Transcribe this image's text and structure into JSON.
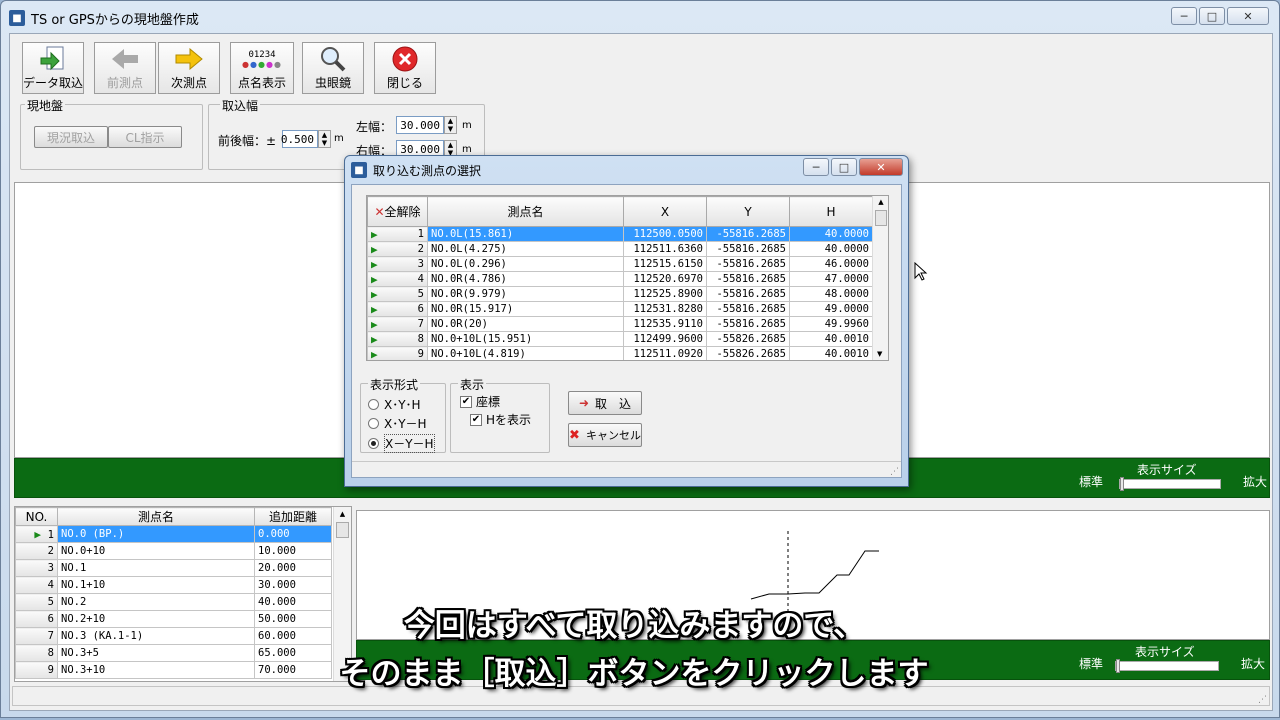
{
  "window": {
    "title": "TS or GPSからの現地盤作成",
    "icon": "app-icon"
  },
  "toolbar": [
    {
      "label": "データ取込",
      "icon": "import-arrow-icon",
      "enabled": true
    },
    {
      "label": "前測点",
      "icon": "left-arrow-icon",
      "enabled": false
    },
    {
      "label": "次測点",
      "icon": "right-arrow-icon",
      "enabled": true
    },
    {
      "label": "点名表示",
      "icon": "point-name-icon",
      "enabled": true,
      "icon_text": "01234"
    },
    {
      "label": "虫眼鏡",
      "icon": "magnifier-icon",
      "enabled": true
    },
    {
      "label": "閉じる",
      "icon": "close-red-icon",
      "enabled": true
    }
  ],
  "genjiban": {
    "label": "現地盤",
    "btn_current": "現況取込",
    "btn_cl": "CL指示"
  },
  "torikomi": {
    "label": "取込幅",
    "front_label": "前後幅：±",
    "front_value": "0.500",
    "unit": "m",
    "left_label": "左幅：",
    "left_value": "30.000",
    "right_label": "右幅：",
    "right_value": "30.000"
  },
  "display_size": {
    "label": "表示サイズ",
    "min": "標準",
    "max": "拡大"
  },
  "list": {
    "headers": [
      "NO.",
      "測点名",
      "追加距離"
    ],
    "rows": [
      {
        "no": "1",
        "name": "NO.0 (BP.)",
        "dist": "0.000"
      },
      {
        "no": "2",
        "name": "NO.0+10",
        "dist": "10.000"
      },
      {
        "no": "3",
        "name": "NO.1",
        "dist": "20.000"
      },
      {
        "no": "4",
        "name": "NO.1+10",
        "dist": "30.000"
      },
      {
        "no": "5",
        "name": "NO.2",
        "dist": "40.000"
      },
      {
        "no": "6",
        "name": "NO.2+10",
        "dist": "50.000"
      },
      {
        "no": "7",
        "name": "NO.3 (KA.1-1)",
        "dist": "60.000"
      },
      {
        "no": "8",
        "name": "NO.3+5",
        "dist": "65.000"
      },
      {
        "no": "9",
        "name": "NO.3+10",
        "dist": "70.000"
      }
    ]
  },
  "dialog": {
    "title": "取り込む測点の選択",
    "headers": [
      "全解除",
      "測点名",
      "X",
      "Y",
      "H"
    ],
    "rows": [
      {
        "no": "1",
        "name": "NO.0L(15.861)",
        "x": "112500.0500",
        "y": "-55816.2685",
        "h": "40.0000"
      },
      {
        "no": "2",
        "name": "NO.0L(4.275)",
        "x": "112511.6360",
        "y": "-55816.2685",
        "h": "40.0000"
      },
      {
        "no": "3",
        "name": "NO.0L(0.296)",
        "x": "112515.6150",
        "y": "-55816.2685",
        "h": "46.0000"
      },
      {
        "no": "4",
        "name": "NO.0R(4.786)",
        "x": "112520.6970",
        "y": "-55816.2685",
        "h": "47.0000"
      },
      {
        "no": "5",
        "name": "NO.0R(9.979)",
        "x": "112525.8900",
        "y": "-55816.2685",
        "h": "48.0000"
      },
      {
        "no": "6",
        "name": "NO.0R(15.917)",
        "x": "112531.8280",
        "y": "-55816.2685",
        "h": "49.0000"
      },
      {
        "no": "7",
        "name": "NO.0R(20)",
        "x": "112535.9110",
        "y": "-55816.2685",
        "h": "49.9960"
      },
      {
        "no": "8",
        "name": "NO.0+10L(15.951)",
        "x": "112499.9600",
        "y": "-55826.2685",
        "h": "40.0010"
      },
      {
        "no": "9",
        "name": "NO.0+10L(4.819)",
        "x": "112511.0920",
        "y": "-55826.2685",
        "h": "40.0010"
      }
    ],
    "format_label": "表示形式",
    "formats": [
      "X･Y･H",
      "X･Y－H",
      "X－Y－H"
    ],
    "format_selected": 2,
    "display_label": "表示",
    "check_coords": "座標",
    "check_h": "Hを表示",
    "btn_import": "取　込",
    "btn_cancel": "キャンセル"
  },
  "subtitles": [
    "今回はすべて取り込みますので、",
    "そのまま［取込］ボタンをクリックします"
  ],
  "colors": {
    "green_bar": "#0b6b13",
    "selection": "#3399ff",
    "close_red": "#e0282a"
  }
}
